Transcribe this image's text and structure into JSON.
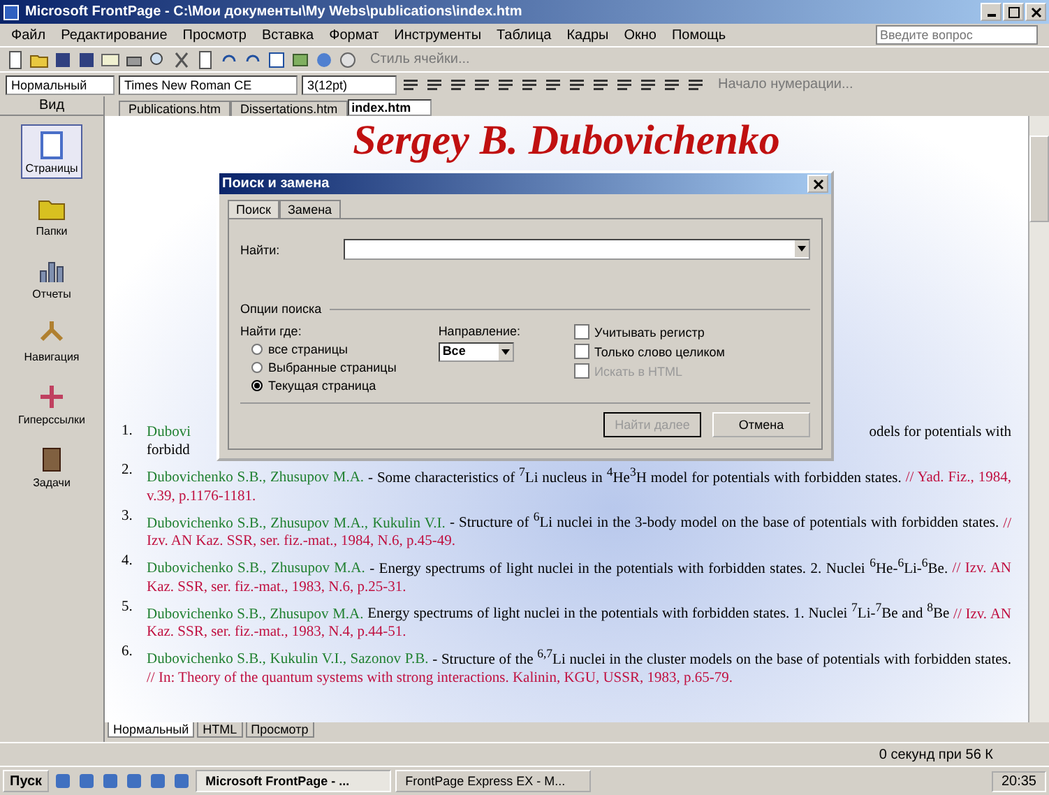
{
  "window": {
    "title": "Microsoft FrontPage - C:\\Мои документы\\My Webs\\publications\\index.htm"
  },
  "menu": [
    "Файл",
    "Редактирование",
    "Просмотр",
    "Вставка",
    "Формат",
    "Инструменты",
    "Таблица",
    "Кадры",
    "Окно",
    "Помощь"
  ],
  "help_box": {
    "placeholder": "Введите вопрос"
  },
  "toolbar": {
    "extra_label": "Стиль ячейки..."
  },
  "format_bar": {
    "style": "Нормальный",
    "font": "Times New Roman CE",
    "size": "3(12pt)",
    "extra_label": "Начало нумерации..."
  },
  "views": {
    "title": "Вид",
    "items": [
      {
        "label": "Страницы",
        "selected": true
      },
      {
        "label": "Папки",
        "selected": false
      },
      {
        "label": "Отчеты",
        "selected": false
      },
      {
        "label": "Навигация",
        "selected": false
      },
      {
        "label": "Гиперссылки",
        "selected": false
      },
      {
        "label": "Задачи",
        "selected": false
      }
    ]
  },
  "doc_tabs": [
    {
      "label": "Publications.htm",
      "selected": false
    },
    {
      "label": "Dissertations.htm",
      "selected": false
    },
    {
      "label": "index.htm",
      "selected": true
    }
  ],
  "page": {
    "heading": "Sergey B. Dubovichenko",
    "first_item": {
      "number": "1.",
      "left": "Dubovi",
      "right": "odels for potentials with",
      "second_line": "forbidd"
    },
    "items": [
      {
        "number": "2.",
        "parts": [
          {
            "kind": "authors",
            "text": "Dubovichenko S.B., Zhusupov M.A."
          },
          {
            "kind": "body",
            "text": " - Some characteristics of $^{7}$Li nucleus in $^{4}$He$^{3}$H model for potentials with forbidden states. "
          },
          {
            "kind": "source",
            "text": "// Yad. Fiz., 1984, v.39, p.1176-1181."
          }
        ]
      },
      {
        "number": "3.",
        "parts": [
          {
            "kind": "authors",
            "text": "Dubovichenko S.B., Zhusupov M.A., Kukulin V.I."
          },
          {
            "kind": "body",
            "text": " - Structure of $^{6}$Li nuclei in the 3-body model on the base of potentials with forbidden states. "
          },
          {
            "kind": "source",
            "text": "// Izv. AN Kaz. SSR, ser. fiz.-mat., 1984, N.6, p.45-49."
          }
        ]
      },
      {
        "number": "4.",
        "parts": [
          {
            "kind": "authors",
            "text": "Dubovichenko S.B., Zhusupov M.A."
          },
          {
            "kind": "body",
            "text": " - Energy spectrums of light nuclei in the potentials with forbidden states. 2. Nuclei $^{6}$He-$^{6}$Li-$^{6}$Be. "
          },
          {
            "kind": "source",
            "text": "// Izv. AN Kaz. SSR, ser. fiz.-mat., 1983, N.6, p.25-31."
          }
        ]
      },
      {
        "number": "5.",
        "parts": [
          {
            "kind": "authors",
            "text": "Dubovichenko S.B., Zhusupov M.A."
          },
          {
            "kind": "body",
            "text": " Energy spectrums of light nuclei in the potentials with forbidden states. 1. Nuclei $^{7}$Li-$^{7}$Be and $^{8}$Be "
          },
          {
            "kind": "source",
            "text": "// Izv. AN Kaz. SSR, ser. fiz.-mat., 1983, N.4, p.44-51."
          }
        ]
      },
      {
        "number": "6.",
        "parts": [
          {
            "kind": "authors",
            "text": "Dubovichenko S.B., Kukulin V.I., Sazonov P.B."
          },
          {
            "kind": "body",
            "text": " - Structure of the $^{6,7}$Li nuclei in the cluster models on the base of potentials with forbidden states. "
          },
          {
            "kind": "source",
            "text": "// In: Theory of the quantum systems with strong interactions. Kalinin, KGU, USSR, 1983, p.65-79."
          }
        ]
      }
    ]
  },
  "dialog": {
    "title": "Поиск и замена",
    "tabs": [
      {
        "label": "Поиск",
        "selected": true
      },
      {
        "label": "Замена",
        "selected": false
      }
    ],
    "find_label": "Найти:",
    "options_title": "Опции поиска",
    "where_label": "Найти где:",
    "where": [
      {
        "label": "все страницы",
        "selected": false
      },
      {
        "label": "Выбранные страницы",
        "selected": false
      },
      {
        "label": "Текущая страница",
        "selected": true
      }
    ],
    "direction_label": "Направление:",
    "direction_value": "Все",
    "checks": [
      {
        "label": "Учитывать регистр",
        "checked": false,
        "disabled": false
      },
      {
        "label": "Только слово целиком",
        "checked": false,
        "disabled": false
      },
      {
        "label": "Искать в HTML",
        "checked": false,
        "disabled": true
      }
    ],
    "buttons": [
      {
        "label": "Найти далее",
        "disabled": true
      },
      {
        "label": "Отмена",
        "disabled": false
      }
    ]
  },
  "view_tabs": [
    {
      "label": "Нормальный",
      "selected": true
    },
    {
      "label": "HTML",
      "selected": false
    },
    {
      "label": "Просмотр",
      "selected": false
    }
  ],
  "status_bar": {
    "text": "0 секунд при 56 К"
  },
  "taskbar": {
    "start": "Пуск",
    "tasks": [
      {
        "label": "Microsoft FrontPage - ...",
        "selected": true
      },
      {
        "label": "FrontPage Express EX - M...",
        "selected": false
      }
    ],
    "clock": "20:35"
  }
}
